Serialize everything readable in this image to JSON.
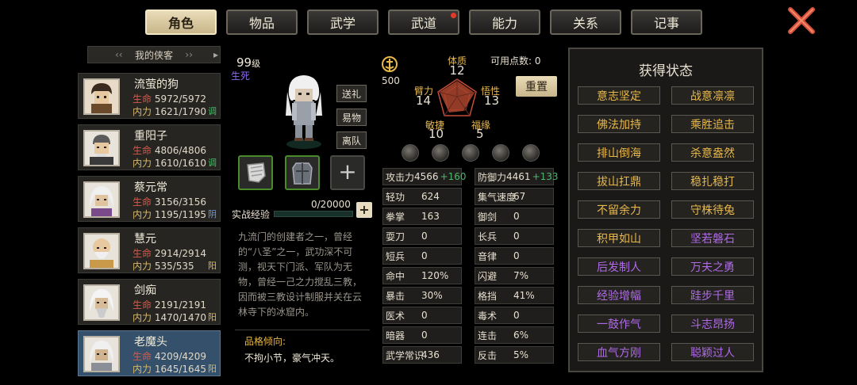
{
  "tabs": [
    {
      "label": "角色"
    },
    {
      "label": "物品"
    },
    {
      "label": "武学"
    },
    {
      "label": "武道"
    },
    {
      "label": "能力"
    },
    {
      "label": "关系"
    },
    {
      "label": "记事"
    }
  ],
  "close_icon": "close-x-icon",
  "list_header": "我的侠客",
  "characters": [
    {
      "name": "流萤的狗",
      "hp": "5972/5972",
      "mp": "1621/1790",
      "tag": "调",
      "tag_color": "#4ab86a",
      "hp_label": "生命",
      "mp_label": "内力"
    },
    {
      "name": "重阳子",
      "hp": "4806/4806",
      "mp": "1610/1610",
      "tag": "调",
      "tag_color": "#4ab86a",
      "hp_label": "生命",
      "mp_label": "内力"
    },
    {
      "name": "蔡元常",
      "hp": "3156/3156",
      "mp": "1195/1195",
      "tag": "阴",
      "tag_color": "#6a9ae8",
      "hp_label": "生命",
      "mp_label": "内力"
    },
    {
      "name": "慧元",
      "hp": "2914/2914",
      "mp": "535/535",
      "tag": "阳",
      "tag_color": "#e8b84a",
      "hp_label": "生命",
      "mp_label": "内力"
    },
    {
      "name": "剑痴",
      "hp": "2191/2191",
      "mp": "1470/1470",
      "tag": "阳",
      "tag_color": "#e8b84a",
      "hp_label": "生命",
      "mp_label": "内力"
    },
    {
      "name": "老魔头",
      "hp": "4209/4209",
      "mp": "1645/1645",
      "tag": "阳",
      "tag_color": "#e8b84a",
      "hp_label": "生命",
      "mp_label": "内力"
    }
  ],
  "selected": {
    "level": "99",
    "level_unit": "级",
    "life_state": "生死",
    "actions": [
      "送礼",
      "易物",
      "离队"
    ],
    "exp_label": "实战经验",
    "exp_value": "0/20000",
    "exp_fraction": 0.0,
    "exp_add": "+",
    "equip_add": "+",
    "description": "九流门的创建者之一，曾经的“八圣”之一，武功深不可测，视天下门派、军队为无物，曾经一己之力搅乱三教，因而被三教设计制服并关在云林寺下的冰窟内。",
    "trait_title": "品格倾向:",
    "trait_text": "不拘小节，豪气冲天。"
  },
  "attributes": {
    "points": "500",
    "avail_label": "可用点数:",
    "avail_value": "0",
    "reset_label": "重置",
    "radar": [
      {
        "label": "体质",
        "value": "12"
      },
      {
        "label": "悟性",
        "value": "13"
      },
      {
        "label": "福缘",
        "value": "5"
      },
      {
        "label": "敏捷",
        "value": "10"
      },
      {
        "label": "臂力",
        "value": "14"
      }
    ]
  },
  "stats": [
    {
      "label": "攻击力",
      "value": "4566",
      "bonus": "+160"
    },
    {
      "label": "防御力",
      "value": "4461",
      "bonus": "+133"
    },
    {
      "label": "轻功",
      "value": "624",
      "bonus": ""
    },
    {
      "label": "集气速度",
      "value": "67",
      "bonus": ""
    },
    {
      "label": "拳掌",
      "value": "163",
      "bonus": ""
    },
    {
      "label": "御剑",
      "value": "0",
      "bonus": ""
    },
    {
      "label": "耍刀",
      "value": "0",
      "bonus": ""
    },
    {
      "label": "长兵",
      "value": "0",
      "bonus": ""
    },
    {
      "label": "短兵",
      "value": "0",
      "bonus": ""
    },
    {
      "label": "音律",
      "value": "0",
      "bonus": ""
    },
    {
      "label": "命中",
      "value": "120%",
      "bonus": ""
    },
    {
      "label": "闪避",
      "value": "7%",
      "bonus": ""
    },
    {
      "label": "暴击",
      "value": "30%",
      "bonus": ""
    },
    {
      "label": "格挡",
      "value": "41%",
      "bonus": ""
    },
    {
      "label": "医术",
      "value": "0",
      "bonus": ""
    },
    {
      "label": "毒术",
      "value": "0",
      "bonus": ""
    },
    {
      "label": "暗器",
      "value": "0",
      "bonus": ""
    },
    {
      "label": "连击",
      "value": "6%",
      "bonus": ""
    },
    {
      "label": "武学常识",
      "value": "436",
      "bonus": ""
    },
    {
      "label": "反击",
      "value": "5%",
      "bonus": ""
    }
  ],
  "status": {
    "title": "获得状态",
    "items": [
      {
        "label": "意志坚定",
        "color": "gold"
      },
      {
        "label": "战意凛凛",
        "color": "gold"
      },
      {
        "label": "佛法加持",
        "color": "gold"
      },
      {
        "label": "乘胜追击",
        "color": "gold"
      },
      {
        "label": "排山倒海",
        "color": "gold"
      },
      {
        "label": "杀意盎然",
        "color": "gold"
      },
      {
        "label": "拔山扛鼎",
        "color": "gold"
      },
      {
        "label": "稳扎稳打",
        "color": "gold"
      },
      {
        "label": "不留余力",
        "color": "gold"
      },
      {
        "label": "守株待兔",
        "color": "gold"
      },
      {
        "label": "积甲如山",
        "color": "gold"
      },
      {
        "label": "坚若磐石",
        "color": "purple"
      },
      {
        "label": "后发制人",
        "color": "purple"
      },
      {
        "label": "万夫之勇",
        "color": "purple"
      },
      {
        "label": "经验增幅",
        "color": "purple"
      },
      {
        "label": "跬步千里",
        "color": "purple"
      },
      {
        "label": "一鼓作气",
        "color": "purple"
      },
      {
        "label": "斗志昂扬",
        "color": "purple"
      },
      {
        "label": "血气方刚",
        "color": "purple"
      },
      {
        "label": "聪颖过人",
        "color": "purple"
      }
    ]
  }
}
